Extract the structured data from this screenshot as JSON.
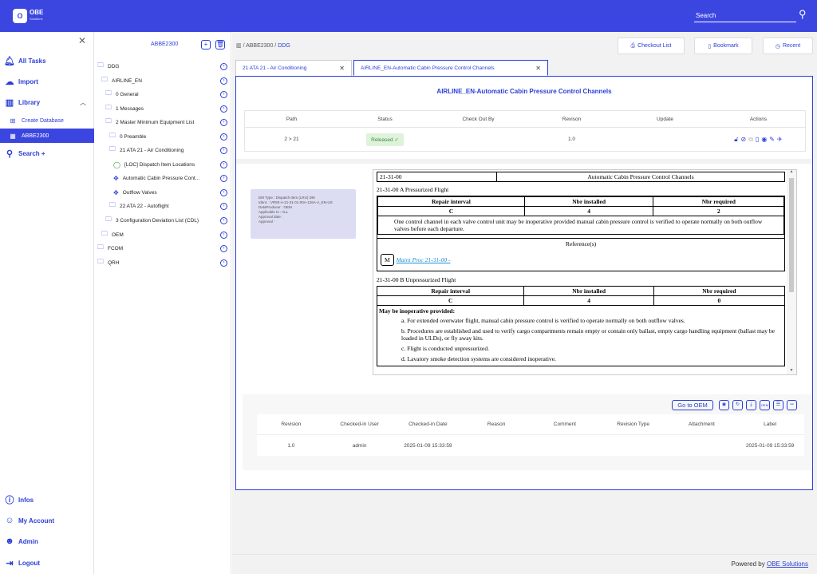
{
  "header": {
    "logo_letter": "O",
    "logo_text": "OBE",
    "logo_sub": "Solutions",
    "search_label": "Search"
  },
  "sidebar": {
    "items": [
      {
        "label": "All Tasks"
      },
      {
        "label": "Import"
      },
      {
        "label": "Library"
      },
      {
        "label": "Create Database"
      },
      {
        "label": "ABBE2300"
      },
      {
        "label": "Search +"
      }
    ],
    "bottom": [
      {
        "label": "Infos"
      },
      {
        "label": "My Account"
      },
      {
        "label": "Admin"
      },
      {
        "label": "Logout"
      }
    ]
  },
  "tree": {
    "title": "ABBE2300",
    "items": [
      "DDG",
      "AIRLINE_EN",
      "0 General",
      "1 Messages",
      "2 Master Minimum Equipment List",
      "0 Preamble",
      "21 ATA 21 - Air Conditioning",
      "[LOC] Dispatch Item Locations",
      "Automatic Cabin Pressure Cont...",
      "Outflow Valves",
      "22 ATA 22 - Autoflight",
      "3 Configuration Deviation List (CDL)",
      "OEM",
      "FCOM",
      "QRH"
    ]
  },
  "breadcrumb": {
    "root": "ABBE2300",
    "sep": "/",
    "last": "DDG"
  },
  "toolbar": {
    "checkout": "Checkout List",
    "bookmark": "Bookmark",
    "recent": "Recent"
  },
  "tabs": [
    {
      "label": "21 ATA 21 - Air Conditioning"
    },
    {
      "label": "AIRLINE_EN-Automatic Cabin Pressure Control Channels"
    }
  ],
  "panel": {
    "title": "AIRLINE_EN-Automatic Cabin Pressure Control Channels",
    "headers": [
      "Path",
      "Status",
      "Check Out By",
      "Revison",
      "Update",
      "Actions"
    ],
    "row": {
      "path": "2 > 21",
      "status": "Released",
      "checkout": "",
      "revision": "1.0",
      "update": ""
    }
  },
  "meta": {
    "lines": [
      "DM Type : Dispatch Item (LRU) DM",
      "Ident. : VR50-A-21-31-01-00A-126A-A_EN-US",
      "DataProducer : OEM",
      "Applicable to : ALL",
      "Approval date :",
      "Approval :"
    ]
  },
  "doc": {
    "code": "21-31-00",
    "title": "Automatic Cabin Pressure Control Channels",
    "secA": "21-31-00 A Pressurized Flight",
    "col1": "Repair interval",
    "col2": "Nbr installed",
    "col3": "Nbr required",
    "a_c1": "C",
    "a_c2": "4",
    "a_c3": "2",
    "a_text": "One control channel in each valve control unit may be inoperative provided manual cabin pressure control is verified to operate normally on both outflow valves before each departure.",
    "ref_label": "Reference(s)",
    "ref_m": "M",
    "ref_link": "Maint Proc 21-31-00 -",
    "secB": "21-31-00 B Unpressurized Flight",
    "b_c1": "C",
    "b_c2": "4",
    "b_c3": "0",
    "b_heading": "May be inoperative provided:",
    "b_items": [
      "a. For extended overwater flight, manual cabin pressure control is verified to operate normally on both outflow valves.",
      "b. Procedures are established and used to verify cargo compartments remain empty or contain only ballast, empty cargo handling equipment (ballast may be loaded in ULDs), or fly away kits.",
      "c. Flight is conducted unpressurized.",
      "d. Lavatory smoke detection systems are considered inoperative."
    ]
  },
  "revisions": {
    "go_label": "Go to OEM",
    "oem_label": "OEM",
    "headers": [
      "Revision",
      "Checked-in User",
      "Checked-in Date",
      "Reason",
      "Comment",
      "Revision Type",
      "Attachment",
      "Label"
    ],
    "row": [
      "1.0",
      "admin",
      "2025-01-09 15:33:59",
      "",
      "",
      "",
      "",
      "2025-01-09 15:33:59"
    ]
  },
  "footer": {
    "prefix": "Powered by",
    "link": "OBE Solutions"
  }
}
